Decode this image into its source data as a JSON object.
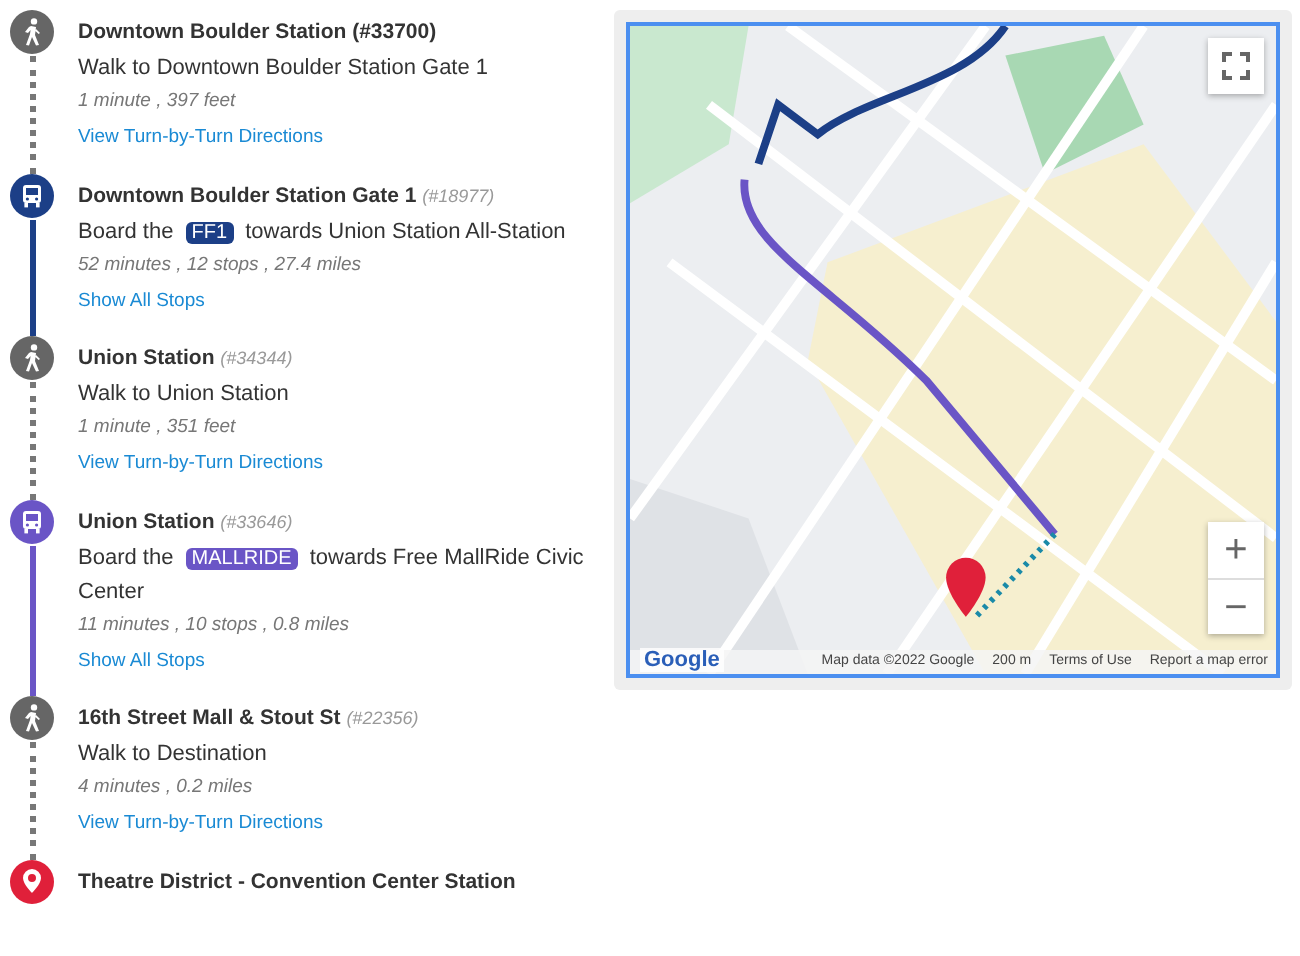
{
  "steps": [
    {
      "kind": "walk",
      "title": "Downtown Boulder Station",
      "stop_id": "(#33700)",
      "id_bold": true,
      "instruction": {
        "text": "Walk to Downtown Boulder Station Gate 1"
      },
      "meta": "1 minute , 397 feet",
      "link": "View Turn-by-Turn Directions"
    },
    {
      "kind": "transit",
      "color": "#1c3f87",
      "title": "Downtown Boulder Station Gate 1",
      "stop_id": "(#18977)",
      "id_bold": false,
      "instruction": {
        "before": "Board the",
        "badge": "FF1",
        "after": "towards Union Station All-Station"
      },
      "meta": "52 minutes , 12 stops , 27.4 miles",
      "link": "Show All Stops"
    },
    {
      "kind": "walk",
      "title": "Union Station",
      "stop_id": "(#34344)",
      "id_bold": false,
      "instruction": {
        "text": "Walk to Union Station"
      },
      "meta": "1 minute , 351 feet",
      "link": "View Turn-by-Turn Directions"
    },
    {
      "kind": "transit",
      "color": "#6a55c6",
      "title": "Union Station",
      "stop_id": "(#33646)",
      "id_bold": false,
      "instruction": {
        "before": "Board the",
        "badge": "MALLRIDE",
        "after": "towards Free MallRide Civic Center"
      },
      "meta": "11 minutes , 10 stops , 0.8 miles",
      "link": "Show All Stops"
    },
    {
      "kind": "walk",
      "title": "16th Street Mall & Stout St",
      "stop_id": "(#22356)",
      "id_bold": false,
      "instruction": {
        "text": "Walk to Destination"
      },
      "meta": "4 minutes , 0.2 miles",
      "link": "View Turn-by-Turn Directions"
    },
    {
      "kind": "destination",
      "title": "Theatre District - Convention Center Station"
    }
  ],
  "map": {
    "kind": "picture",
    "zoom_in": "+",
    "zoom_out": "−",
    "logo": "Google",
    "attribution": "Map data ©2022 Google",
    "scale": "200 m",
    "terms": "Terms of Use",
    "report": "Report a map error"
  }
}
